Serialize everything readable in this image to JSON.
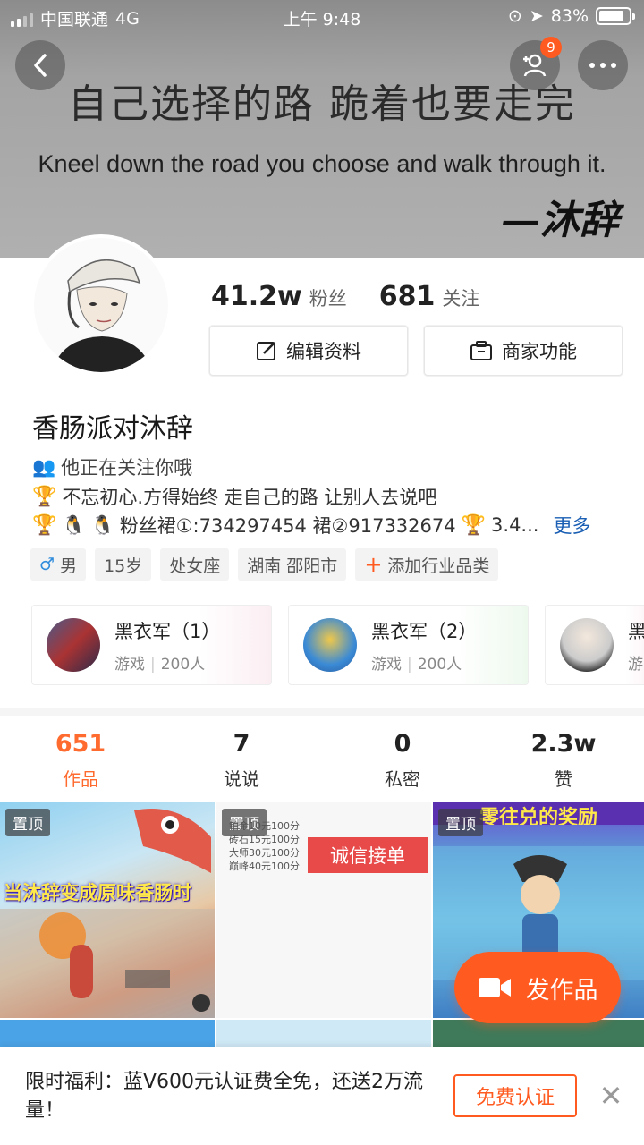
{
  "status_bar": {
    "carrier": "中国联通",
    "network": "4G",
    "time": "上午 9:48",
    "battery": "83%",
    "battery_level": 0.83
  },
  "header": {
    "friend_badge": "9",
    "banner_cn": "自己选择的路  跪着也要走完",
    "banner_en": "Kneel down the road you choose and walk through it.",
    "banner_sign": "—沐辞"
  },
  "profile": {
    "fans_count": "41.2w",
    "fans_label": "粉丝",
    "following_count": "681",
    "following_label": "关注",
    "edit_label": "编辑资料",
    "business_label": "商家功能",
    "nickname": "香肠派对沐辞",
    "follows_you": "他正在关注你哦",
    "bio_line1": "不忘初心.方得始终 走自己的路 让别人去说吧",
    "bio_line2": "粉丝裙①:734297454 裙②917332674",
    "bio_line2_tail": "3.4...",
    "more_label": "更多",
    "tags": {
      "gender": "男",
      "age": "15岁",
      "zodiac": "处女座",
      "location": "湖南 邵阳市",
      "add_industry": "添加行业品类"
    }
  },
  "groups": [
    {
      "name": "黑衣军（1）",
      "category": "游戏",
      "members": "200人"
    },
    {
      "name": "黑衣军（2）",
      "category": "游戏",
      "members": "200人"
    },
    {
      "name": "黑",
      "category": "游",
      "members": ""
    }
  ],
  "tabs": [
    {
      "count": "651",
      "label": "作品"
    },
    {
      "count": "7",
      "label": "说说"
    },
    {
      "count": "0",
      "label": "私密"
    },
    {
      "count": "2.3w",
      "label": "赞"
    }
  ],
  "grid": {
    "pin_label": "置顶",
    "cell1_caption": "当沐辞变成原味香肠时",
    "cell2_prices": [
      "铂金10元100分",
      "砖石15元100分",
      "大师30元100分",
      "巅峰40元100分"
    ],
    "cell2_banner": "诚信接单",
    "cell3_caption": "零往兑的奖励"
  },
  "fab": {
    "label": "发作品"
  },
  "promo": {
    "text": "限时福利：蓝V600元认证费全免，还送2万流量！",
    "button": "免费认证"
  },
  "colors": {
    "accent": "#ff5a1f",
    "tab_active": "#ff6a2e",
    "link": "#1a5fb4"
  }
}
